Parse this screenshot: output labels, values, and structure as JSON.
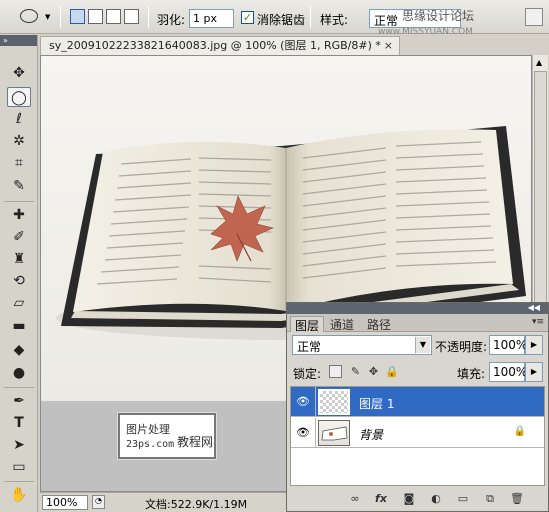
{
  "options_bar": {
    "feather_label": "羽化:",
    "feather_value": "1 px",
    "antialias_label": "消除锯齿",
    "antialias_checked": true,
    "style_label": "样式:",
    "style_value": "正常",
    "watermark_text": "思缘设计论坛",
    "watermark_url": "www.MISSYUAN.COM"
  },
  "document": {
    "tab_title": "sy_20091022233821640083.jpg @ 100% (图层 1, RGB/8#) *",
    "close_glyph": "×",
    "zoom": "100%",
    "doc_info": "文档:522.9K/1.19M"
  },
  "watermark_box": {
    "line1": "图片处理",
    "line2": "23ps.com",
    "line3": "教程网"
  },
  "layers_panel": {
    "tabs": [
      "图层",
      "通道",
      "路径"
    ],
    "blend_mode": "正常",
    "opacity_label": "不透明度:",
    "opacity_value": "100%",
    "lock_label": "锁定:",
    "fill_label": "填充:",
    "fill_value": "100%",
    "layers": [
      {
        "name": "图层 1",
        "selected": true,
        "visible": true,
        "locked": false
      },
      {
        "name": "背景",
        "selected": false,
        "visible": true,
        "locked": true
      }
    ]
  },
  "colors": {
    "selection": "#316ac5",
    "panel_bg": "#d8d6cf",
    "toolbar_bg": "#d6d3cb"
  }
}
